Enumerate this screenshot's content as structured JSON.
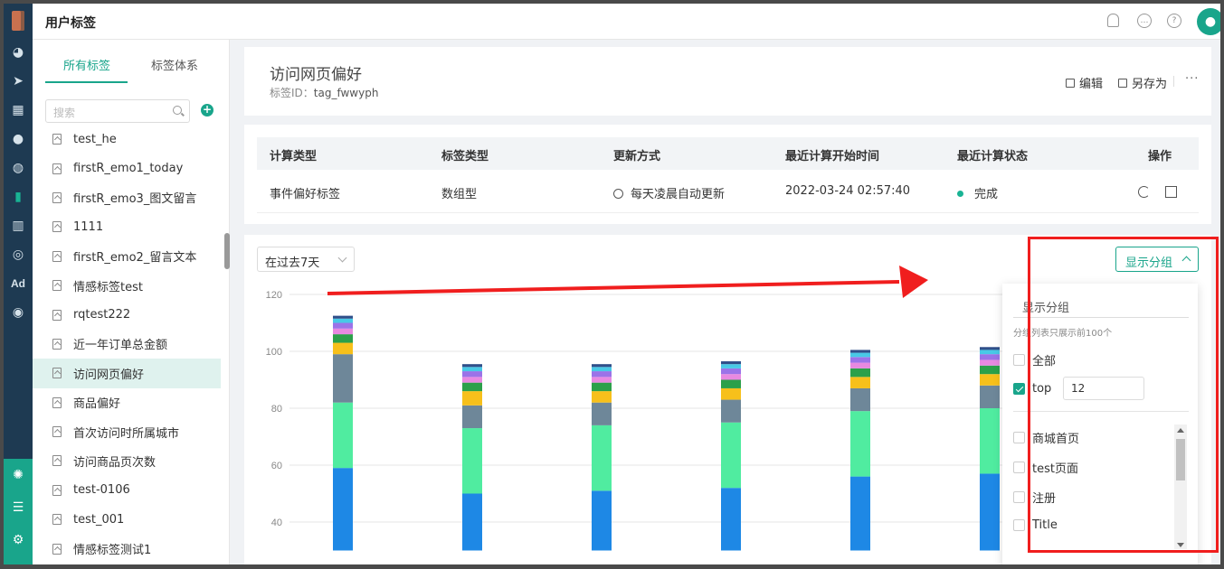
{
  "app": {
    "title": "用户标签"
  },
  "sidebar": {
    "tabs": [
      "所有标签",
      "标签体系"
    ],
    "search_placeholder": "搜索",
    "add_label": "+",
    "items": [
      {
        "label": "test_he"
      },
      {
        "label": "firstR_emo1_today"
      },
      {
        "label": "firstR_emo3_图文留言"
      },
      {
        "label": "1111"
      },
      {
        "label": "firstR_emo2_留言文本"
      },
      {
        "label": "情感标签test"
      },
      {
        "label": "rqtest222"
      },
      {
        "label": "近一年订单总金额"
      },
      {
        "label": "访问网页偏好",
        "active": true
      },
      {
        "label": "商品偏好"
      },
      {
        "label": "首次访问时所属城市"
      },
      {
        "label": "访问商品页次数"
      },
      {
        "label": "test-0106"
      },
      {
        "label": "test_001"
      },
      {
        "label": "情感标签测试1"
      }
    ]
  },
  "detail": {
    "name": "访问网页偏好",
    "tag_id_label": "标签ID：",
    "tag_id": "tag_fwwyph",
    "edit_label": "编辑",
    "save_as_label": "另存为",
    "more_label": "···"
  },
  "table": {
    "headers": [
      "计算类型",
      "标签类型",
      "更新方式",
      "最近计算开始时间",
      "最近计算状态",
      "操作"
    ],
    "row": [
      "事件偏好标签",
      "数组型",
      "每天凌晨自动更新",
      "2022-03-24 02:57:40",
      "完成"
    ]
  },
  "chart_section": {
    "range": "在过去7天",
    "group_button": "显示分组"
  },
  "dropdown": {
    "title": "显示分组",
    "note": "分组列表只展示前100个",
    "all_label": "全部",
    "top_label": "top",
    "top_value": "12",
    "options": [
      "商城首页",
      "test页面",
      "注册",
      "Title"
    ]
  },
  "colors": {
    "accent": "#19a58b",
    "annotation": "#f01e1e"
  },
  "chart_data": {
    "type": "bar",
    "stacked": true,
    "yticks": [
      40,
      60,
      80,
      100,
      120
    ],
    "ylim": [
      30,
      120
    ],
    "series": [
      {
        "color": "#1e88e5",
        "values": [
          59,
          50,
          51,
          52,
          56,
          57
        ]
      },
      {
        "color": "#50eca0",
        "values": [
          23,
          23,
          23,
          23,
          23,
          23
        ]
      },
      {
        "color": "#6e8799",
        "values": [
          17,
          8,
          8,
          8,
          8,
          8
        ]
      },
      {
        "color": "#f7c01b",
        "values": [
          4,
          5,
          4,
          4,
          4,
          4
        ]
      },
      {
        "color": "#2ca04a",
        "values": [
          3,
          3,
          3,
          3,
          3,
          3
        ]
      },
      {
        "color": "#e889e0",
        "values": [
          2,
          2,
          2,
          2,
          2,
          2
        ]
      },
      {
        "color": "#9b73e8",
        "values": [
          2,
          2,
          2,
          2,
          2,
          2
        ]
      },
      {
        "color": "#48c9e6",
        "values": [
          1.5,
          1.5,
          1.5,
          1.5,
          1.5,
          1.5
        ]
      },
      {
        "color": "#2f4f8a",
        "values": [
          1,
          1,
          1,
          1,
          1,
          1
        ]
      }
    ]
  }
}
